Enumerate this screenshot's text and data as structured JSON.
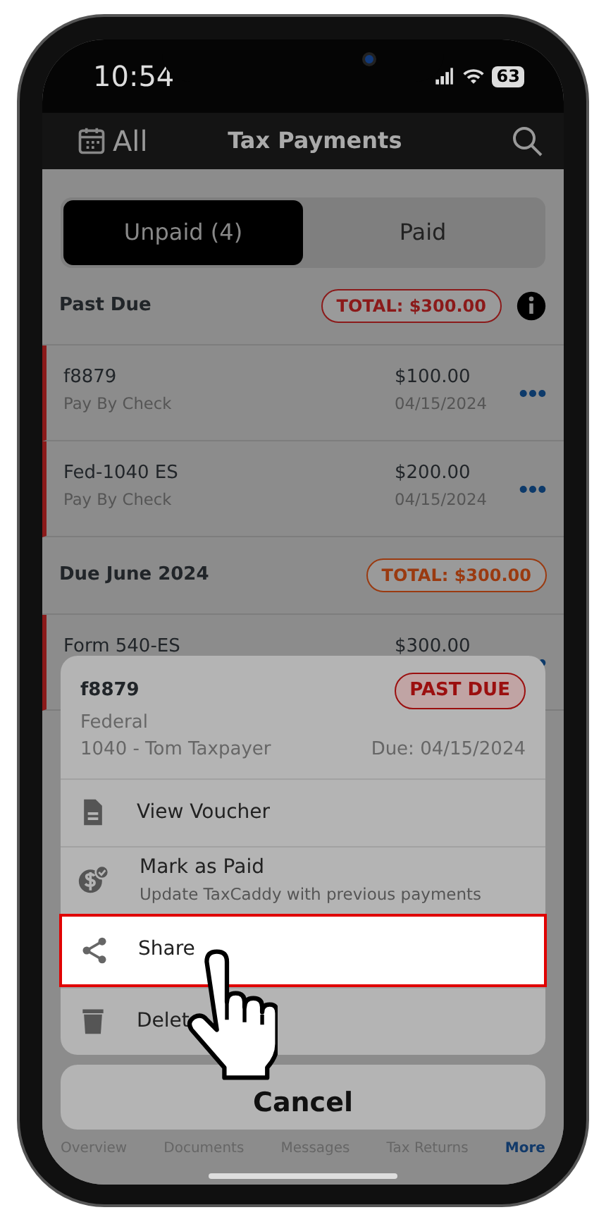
{
  "status_bar": {
    "time": "10:54",
    "battery": "63"
  },
  "nav": {
    "filter": "All",
    "title": "Tax Payments"
  },
  "segments": [
    {
      "label": "Unpaid (4)",
      "selected": true
    },
    {
      "label": "Paid",
      "selected": false
    }
  ],
  "sections": [
    {
      "title": "Past Due",
      "total": "TOTAL: $300.00",
      "color": "#8b1a1a",
      "info": true,
      "items": [
        {
          "name": "f8879",
          "method": "Pay By Check",
          "amount": "$100.00",
          "date": "04/15/2024"
        },
        {
          "name": "Fed-1040 ES",
          "method": "Pay By Check",
          "amount": "$200.00",
          "date": "04/15/2024"
        }
      ]
    },
    {
      "title": "Due June 2024",
      "total": "TOTAL: $300.00",
      "color": "#9a3a10",
      "info": false,
      "items": [
        {
          "name": "Form 540-ES",
          "amount": "$300.00"
        }
      ]
    }
  ],
  "sheet": {
    "title": "f8879",
    "badge": "PAST DUE",
    "jurisdiction": "Federal",
    "return": "1040 - Tom Taxpayer",
    "due": "Due: 04/15/2024",
    "actions": [
      {
        "kind": "document",
        "label": "View Voucher",
        "selected": false
      },
      {
        "kind": "paid",
        "label": "Mark as Paid",
        "subtitle": "Update TaxCaddy with previous payments",
        "selected": false
      },
      {
        "kind": "share",
        "label": "Share",
        "selected": true
      },
      {
        "kind": "trash",
        "label": "Delet",
        "selected": false
      }
    ]
  },
  "cancel": "Cancel",
  "tab_bar": [
    {
      "label": "Overview",
      "selected": false
    },
    {
      "label": "Documents",
      "selected": false
    },
    {
      "label": "Messages",
      "selected": false
    },
    {
      "label": "Tax Returns",
      "selected": false
    },
    {
      "label": "More",
      "selected": true
    }
  ]
}
